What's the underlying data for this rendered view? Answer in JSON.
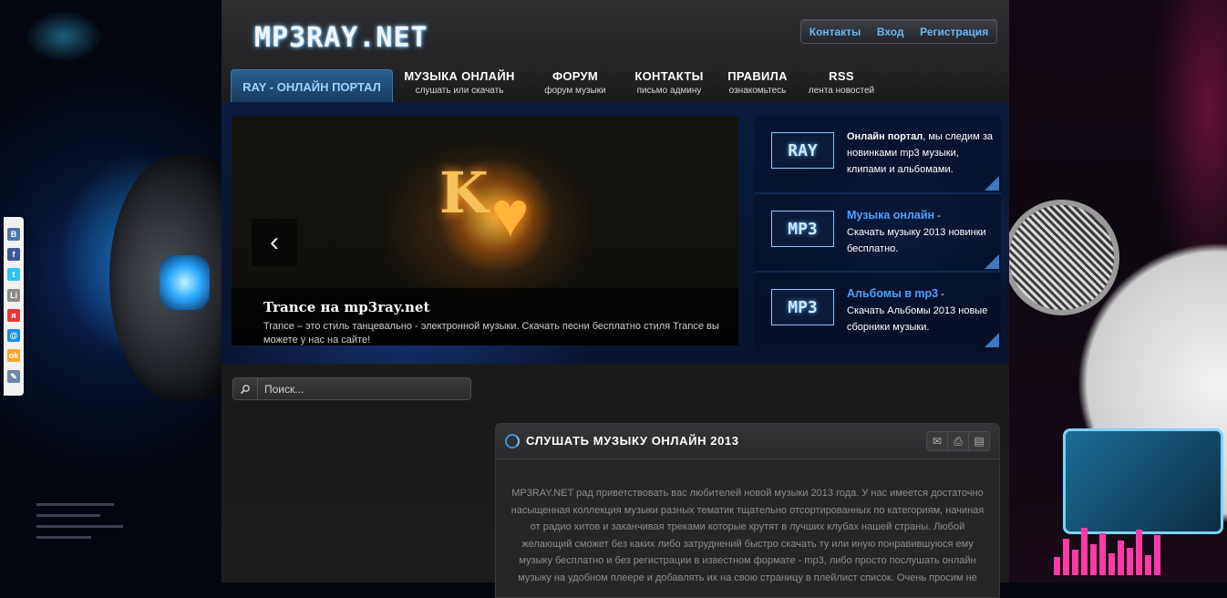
{
  "site": {
    "logo": "MP3RAY.NET"
  },
  "top_links": [
    "Контакты",
    "Вход",
    "Регистрация"
  ],
  "nav": {
    "active": "RAY - ОНЛАЙН ПОРТАЛ",
    "items": [
      {
        "title": "МУЗЫКА ОНЛАЙН",
        "sub": "слушать или скачать"
      },
      {
        "title": "ФОРУМ",
        "sub": "форум музыки"
      },
      {
        "title": "КОНТАКТЫ",
        "sub": "письмо админу"
      },
      {
        "title": "ПРАВИЛА",
        "sub": "ознакомьтесь"
      },
      {
        "title": "RSS",
        "sub": "лента новостей"
      }
    ]
  },
  "slider": {
    "prev_glyph": "‹",
    "art_letter": "K",
    "art_heart": "♥",
    "caption_title": "Trance на mp3ray.net",
    "caption_text": "Trance – это стиль танцевально - электронной музыки. Скачать песни бесплатно стиля Trance вы можете у нас на сайте!"
  },
  "features": [
    {
      "badge": "RAY",
      "title": "Онлайн портал",
      "title_style": "white",
      "suffix": ", мы следим",
      "text": "за новинками mp3 музыки, клипами и альбомами."
    },
    {
      "badge": "MP3",
      "title": "Музыка онлайн",
      "title_style": "blue",
      "suffix": " -",
      "text": "Скачать музыку 2013 новинки бесплатно."
    },
    {
      "badge": "MP3",
      "title": "Альбомы в mp3",
      "title_style": "blue",
      "suffix": " -",
      "text": "Скачать Альбомы 2013 новые сборники музыки."
    }
  ],
  "search": {
    "icon": "search-icon",
    "placeholder": "Поиск..."
  },
  "panel": {
    "title": "СЛУШАТЬ МУЗЫКУ ОНЛАЙН 2013",
    "tools": [
      "mail-icon",
      "print-icon",
      "document-icon"
    ],
    "body": "MP3RAY.NET рад приветствовать вас любителей новой музыки 2013 года. У нас имеется достаточно насыщенная коллекция музыки разных тематик тщательно отсортированных по категориям, начиная от радио хитов и заканчивая треками которые крутят в лучших клубах нашей страны. Любой желающий сможет без каких либо затруднений быстро скачать ту или иную понравившуюся ему музыку бесплатно и без регистрации в известном формате - mp3, либо просто послушать онлайн музыку на удобном плеере и добавлять их на свою страницу в плейлист список. Очень просим не"
  },
  "share": [
    {
      "label": "В",
      "color": "#4a76a8"
    },
    {
      "label": "f",
      "color": "#3b5998"
    },
    {
      "label": "t",
      "color": "#2fc2ef"
    },
    {
      "label": "Li",
      "color": "#8a8a8a"
    },
    {
      "label": "я",
      "color": "#e53935"
    },
    {
      "label": "@",
      "color": "#168de2"
    },
    {
      "label": "ok",
      "color": "#f5a623"
    },
    {
      "label": "✎",
      "color": "#6e87a8"
    }
  ]
}
